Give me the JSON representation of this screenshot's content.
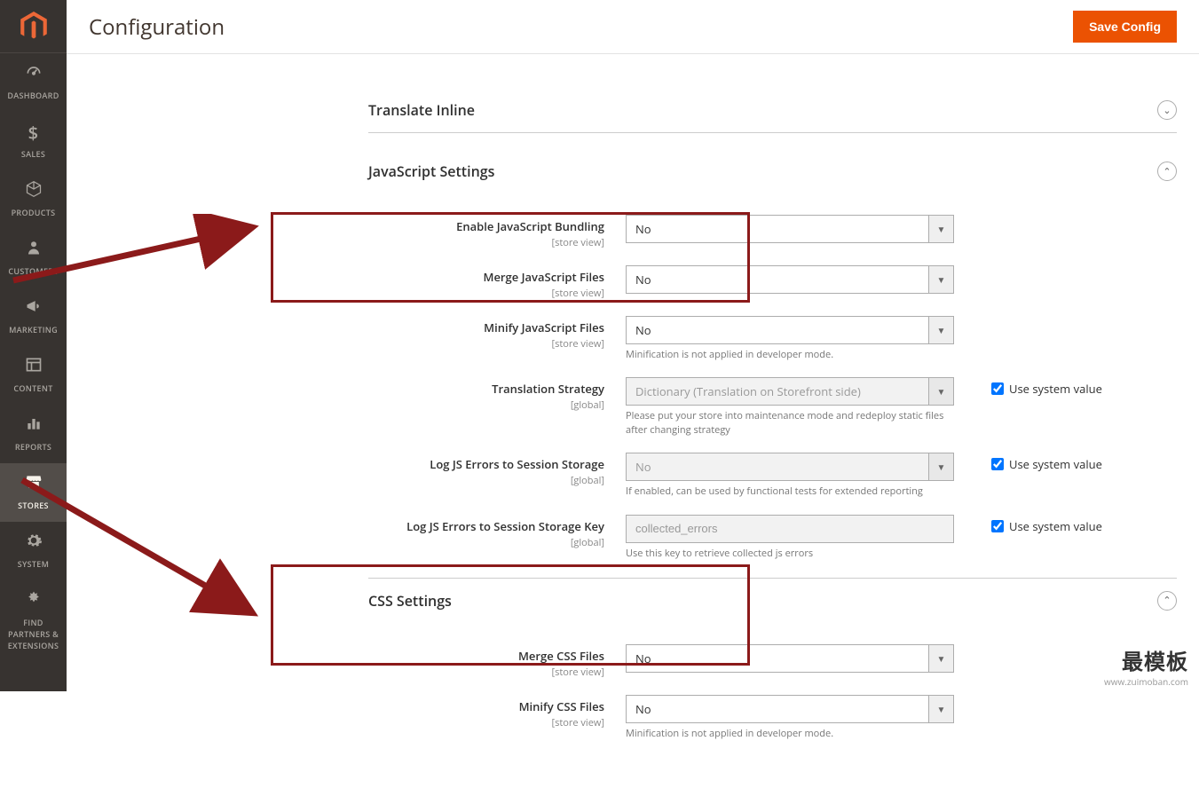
{
  "header": {
    "title": "Configuration",
    "save_button": "Save Config"
  },
  "sidebar": {
    "items": [
      {
        "label": "DASHBOARD"
      },
      {
        "label": "SALES"
      },
      {
        "label": "PRODUCTS"
      },
      {
        "label": "CUSTOMERS"
      },
      {
        "label": "MARKETING"
      },
      {
        "label": "CONTENT"
      },
      {
        "label": "REPORTS"
      },
      {
        "label": "STORES"
      },
      {
        "label": "SYSTEM"
      },
      {
        "label": "FIND PARTNERS & EXTENSIONS"
      }
    ]
  },
  "sections": {
    "translate_inline": {
      "title": "Translate Inline"
    },
    "js": {
      "title": "JavaScript Settings",
      "fields": {
        "bundling": {
          "label": "Enable JavaScript Bundling",
          "scope": "[store view]",
          "value": "No"
        },
        "merge": {
          "label": "Merge JavaScript Files",
          "scope": "[store view]",
          "value": "No"
        },
        "minify": {
          "label": "Minify JavaScript Files",
          "scope": "[store view]",
          "value": "No",
          "note": "Minification is not applied in developer mode."
        },
        "translation": {
          "label": "Translation Strategy",
          "scope": "[global]",
          "value": "Dictionary (Translation on Storefront side)",
          "note": "Please put your store into maintenance mode and redeploy static files after changing strategy"
        },
        "log_errors": {
          "label": "Log JS Errors to Session Storage",
          "scope": "[global]",
          "value": "No",
          "note": "If enabled, can be used by functional tests for extended reporting"
        },
        "log_key": {
          "label": "Log JS Errors to Session Storage Key",
          "scope": "[global]",
          "value": "collected_errors",
          "note": "Use this key to retrieve collected js errors"
        }
      }
    },
    "css": {
      "title": "CSS Settings",
      "fields": {
        "merge": {
          "label": "Merge CSS Files",
          "scope": "[store view]",
          "value": "No"
        },
        "minify": {
          "label": "Minify CSS Files",
          "scope": "[store view]",
          "value": "No",
          "note": "Minification is not applied in developer mode."
        }
      }
    }
  },
  "labels": {
    "use_system_value": "Use system value"
  },
  "watermark": {
    "main": "最模板",
    "sub": "www.zuimoban.com"
  }
}
